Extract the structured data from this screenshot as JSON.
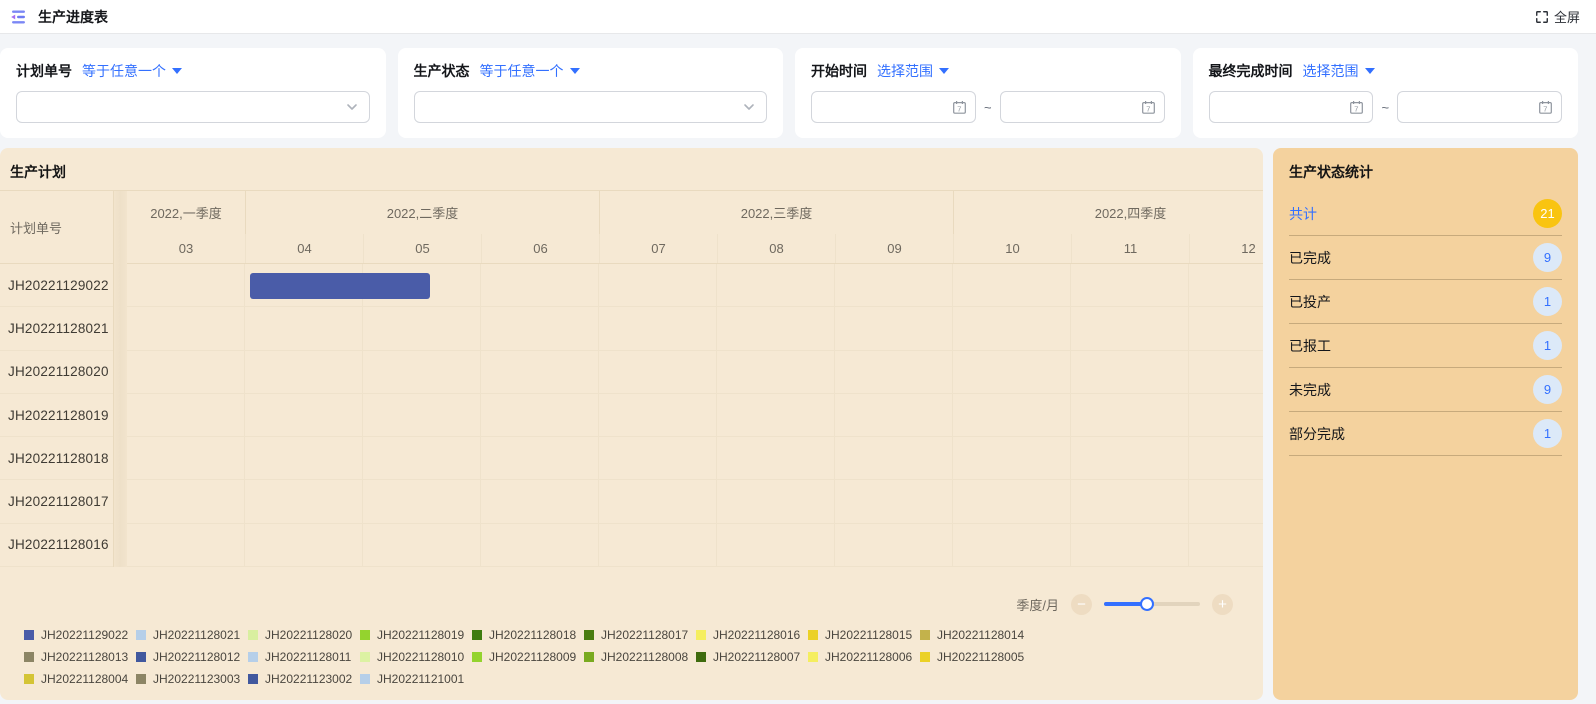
{
  "header": {
    "title": "生产进度表",
    "fullscreen_label": "全屏"
  },
  "filters": [
    {
      "label": "计划单号",
      "operator": "等于任意一个",
      "type": "select"
    },
    {
      "label": "生产状态",
      "operator": "等于任意一个",
      "type": "select"
    },
    {
      "label": "开始时间",
      "operator": "选择范围",
      "type": "daterange",
      "separator": "~"
    },
    {
      "label": "最终完成时间",
      "operator": "选择范围",
      "type": "daterange",
      "separator": "~"
    }
  ],
  "gantt": {
    "title": "生产计划",
    "row_header": "计划单号",
    "quarters": [
      {
        "label": "2022,一季度",
        "months": [
          "03"
        ]
      },
      {
        "label": "2022,二季度",
        "months": [
          "04",
          "05",
          "06"
        ]
      },
      {
        "label": "2022,三季度",
        "months": [
          "07",
          "08",
          "09"
        ]
      },
      {
        "label": "2022,四季度",
        "months": [
          "10",
          "11",
          "12"
        ]
      }
    ],
    "rows": [
      "JH20221129022",
      "JH20221128021",
      "JH20221128020",
      "JH20221128019",
      "JH20221128018",
      "JH20221128017",
      "JH20221128016"
    ],
    "bars": [
      {
        "row": 0,
        "plan": "JH20221129022",
        "start_month_offset": 1.04,
        "duration_months": 1.53,
        "color": "#4a5ca8"
      }
    ],
    "zoom_label": "季度/月",
    "slider_percent": 45
  },
  "legend": [
    {
      "name": "JH20221129022",
      "color": "#4a5ca8"
    },
    {
      "name": "JH20221128021",
      "color": "#b6cfe9"
    },
    {
      "name": "JH20221128020",
      "color": "#d9efa0"
    },
    {
      "name": "JH20221128019",
      "color": "#94d32e"
    },
    {
      "name": "JH20221128018",
      "color": "#3f7d10"
    },
    {
      "name": "JH20221128017",
      "color": "#4a7d10"
    },
    {
      "name": "JH20221128016",
      "color": "#f5ee5f"
    },
    {
      "name": "JH20221128015",
      "color": "#ebd125"
    },
    {
      "name": "JH20221128014",
      "color": "#c3b24b"
    },
    {
      "name": "JH20221128013",
      "color": "#8c8565"
    },
    {
      "name": "JH20221128012",
      "color": "#41589e"
    },
    {
      "name": "JH20221128011",
      "color": "#b6cfe9"
    },
    {
      "name": "JH20221128010",
      "color": "#dcf2a3"
    },
    {
      "name": "JH20221128009",
      "color": "#94d32e"
    },
    {
      "name": "JH20221128008",
      "color": "#79aa20"
    },
    {
      "name": "JH20221128007",
      "color": "#3f6b0e"
    },
    {
      "name": "JH20221128006",
      "color": "#f5ee5f"
    },
    {
      "name": "JH20221128005",
      "color": "#ebd125"
    },
    {
      "name": "JH20221128004",
      "color": "#d4c435"
    },
    {
      "name": "JH20221123003",
      "color": "#8c8565"
    },
    {
      "name": "JH20221123002",
      "color": "#41589e"
    },
    {
      "name": "JH20221121001",
      "color": "#b6cfe9"
    }
  ],
  "stats": {
    "title": "生产状态统计",
    "items": [
      {
        "label": "共计",
        "value": "21",
        "highlight": true
      },
      {
        "label": "已完成",
        "value": "9",
        "highlight": false
      },
      {
        "label": "已投产",
        "value": "1",
        "highlight": false
      },
      {
        "label": "已报工",
        "value": "1",
        "highlight": false
      },
      {
        "label": "未完成",
        "value": "9",
        "highlight": false
      },
      {
        "label": "部分完成",
        "value": "1",
        "highlight": false
      }
    ]
  },
  "colors": {
    "accent_blue": "#3370ff",
    "gantt_panel_bg": "#f6e9d4",
    "stats_panel_bg": "#f4d29e",
    "total_badge_bg": "#f9c411",
    "count_badge_bg": "#dce9f8",
    "bar_color": "#4a5ca8"
  }
}
